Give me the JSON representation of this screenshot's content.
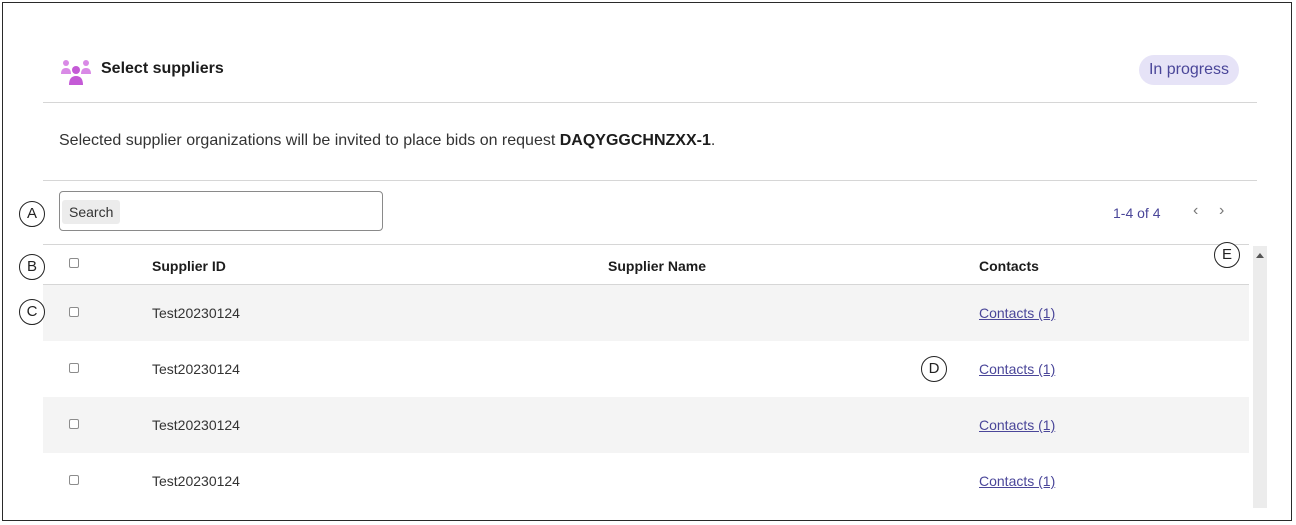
{
  "header": {
    "title": "Select suppliers",
    "status": "In progress"
  },
  "description": {
    "prefix": "Selected supplier organizations will be invited to place bids on request ",
    "request_id": "DAQYGGCHNZXX-1",
    "suffix": "."
  },
  "search": {
    "label": "Search"
  },
  "pagination": {
    "range": "1-4 of 4",
    "prev_icon": "chevron-left-icon",
    "next_icon": "chevron-right-icon"
  },
  "table": {
    "columns": [
      "Supplier ID",
      "Supplier Name",
      "Contacts"
    ],
    "rows": [
      {
        "supplier_id": "Test20230124",
        "supplier_name": "",
        "contacts": "Contacts (1)"
      },
      {
        "supplier_id": "Test20230124",
        "supplier_name": "",
        "contacts": "Contacts (1)"
      },
      {
        "supplier_id": "Test20230124",
        "supplier_name": "",
        "contacts": "Contacts (1)"
      },
      {
        "supplier_id": "Test20230124",
        "supplier_name": "",
        "contacts": "Contacts (1)"
      }
    ]
  },
  "callouts": [
    "A",
    "B",
    "C",
    "D",
    "E"
  ],
  "colors": {
    "accent": "#4a4699",
    "badge_bg": "#e6e3f7",
    "icon": "#c45ad6",
    "row_alt": "#f4f4f4"
  }
}
